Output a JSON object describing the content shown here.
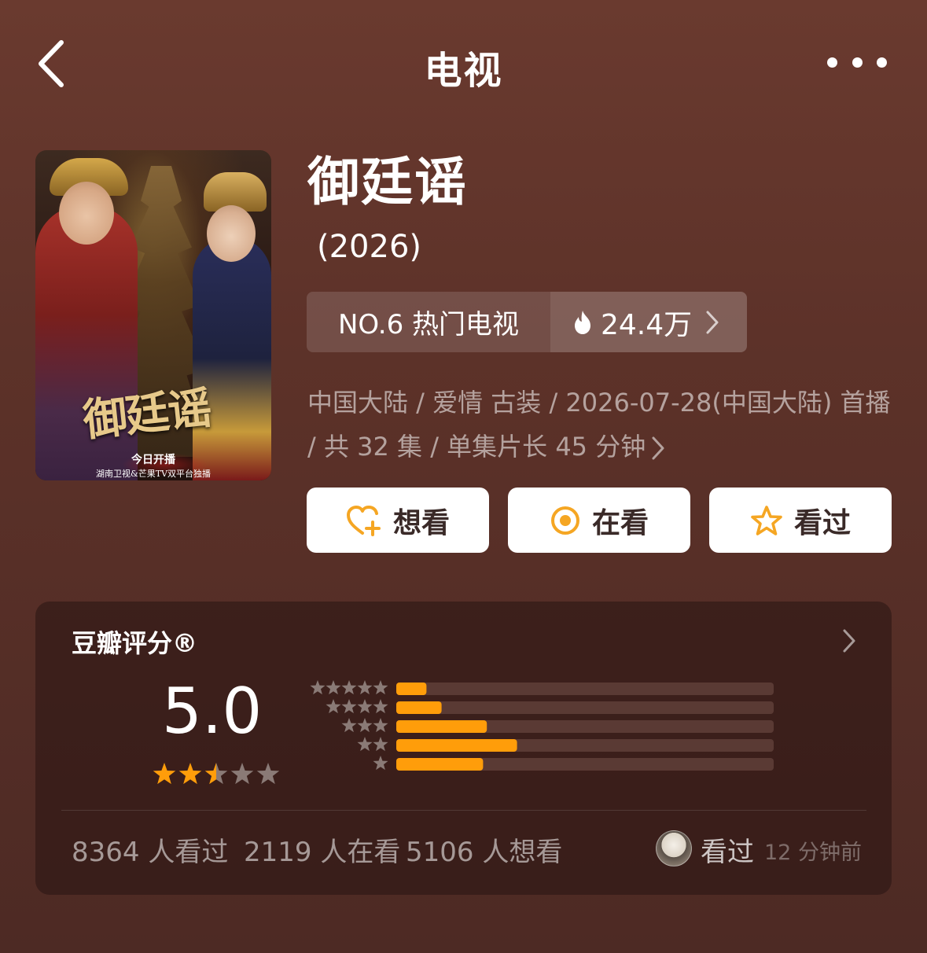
{
  "header": {
    "title": "电视"
  },
  "poster": {
    "title": "御廷谣",
    "subtitle": "今日开播",
    "subtitle2": "湖南卫视&芒果TV双平台独播"
  },
  "show": {
    "title": "御廷谣",
    "year": "(2026)"
  },
  "rank": {
    "label": "NO.6 热门电视",
    "heat": "24.4万"
  },
  "meta": {
    "text": "中国大陆 / 爱情 古装 / 2026-07-28(中国大陆) 首播 / 共 32 集 / 单集片长 45 分钟"
  },
  "actions": [
    {
      "label": "想看",
      "icon": "heart-plus-icon"
    },
    {
      "label": "在看",
      "icon": "target-icon"
    },
    {
      "label": "看过",
      "icon": "star-outline-icon"
    }
  ],
  "rating": {
    "heading": "豆瓣评分®",
    "score": "5.0",
    "stars_value": 2.5,
    "stars_max": 5,
    "distribution": [
      {
        "stars": 5,
        "fraction": 0.08
      },
      {
        "stars": 4,
        "fraction": 0.12
      },
      {
        "stars": 3,
        "fraction": 0.24
      },
      {
        "stars": 2,
        "fraction": 0.32
      },
      {
        "stars": 1,
        "fraction": 0.23
      }
    ],
    "accent_color": "#ff9d0a",
    "track_color": "#5a3a34"
  },
  "stats": {
    "watched": "8364 人看过",
    "watching": "2119 人在看",
    "want": "5106 人想看"
  },
  "recent": {
    "label": "看过",
    "time": "12 分钟前"
  }
}
